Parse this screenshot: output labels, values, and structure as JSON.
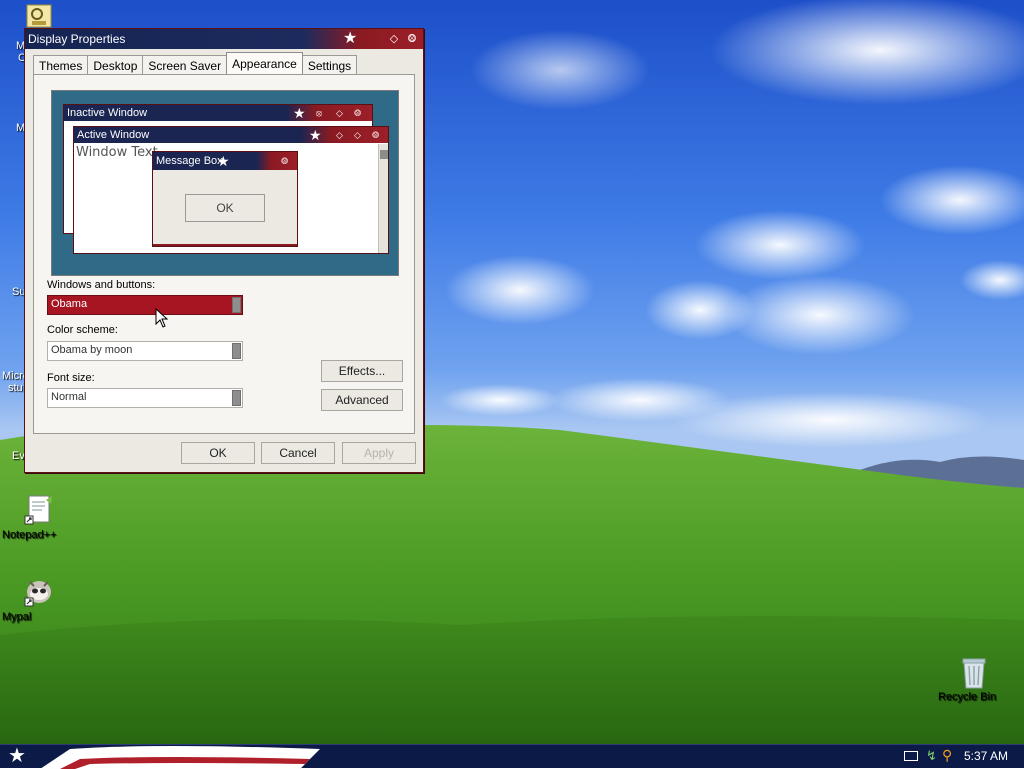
{
  "desktop": {
    "icons": [
      {
        "label": "Notepad++"
      },
      {
        "label": "Mypal"
      },
      {
        "label": "Recycle Bin"
      }
    ],
    "partial_labels": [
      "M",
      "C",
      "M",
      "Su",
      "Micro",
      "stu",
      "Ev"
    ]
  },
  "window": {
    "title": "Display Properties",
    "tabs": [
      "Themes",
      "Desktop",
      "Screen Saver",
      "Appearance",
      "Settings"
    ],
    "active_tab": "Appearance",
    "preview": {
      "inactive_title": "Inactive Window",
      "active_title": "Active Window",
      "window_text": "Window Text",
      "msgbox_title": "Message Box",
      "msgbox_ok": "OK"
    },
    "windows_buttons_label": "Windows and buttons:",
    "windows_buttons_value": "Obama",
    "color_scheme_label": "Color scheme:",
    "color_scheme_value": "Obama by moon",
    "font_size_label": "Font size:",
    "font_size_value": "Normal",
    "effects_button": "Effects...",
    "advanced_button": "Advanced",
    "ok_button": "OK",
    "cancel_button": "Cancel",
    "apply_button": "Apply"
  },
  "taskbar": {
    "clock": "5:37 AM"
  },
  "colors": {
    "title_navy": "#152452",
    "title_red": "#9c1f28",
    "selection_red": "#a61521",
    "taskbar": "#0c1a47"
  }
}
